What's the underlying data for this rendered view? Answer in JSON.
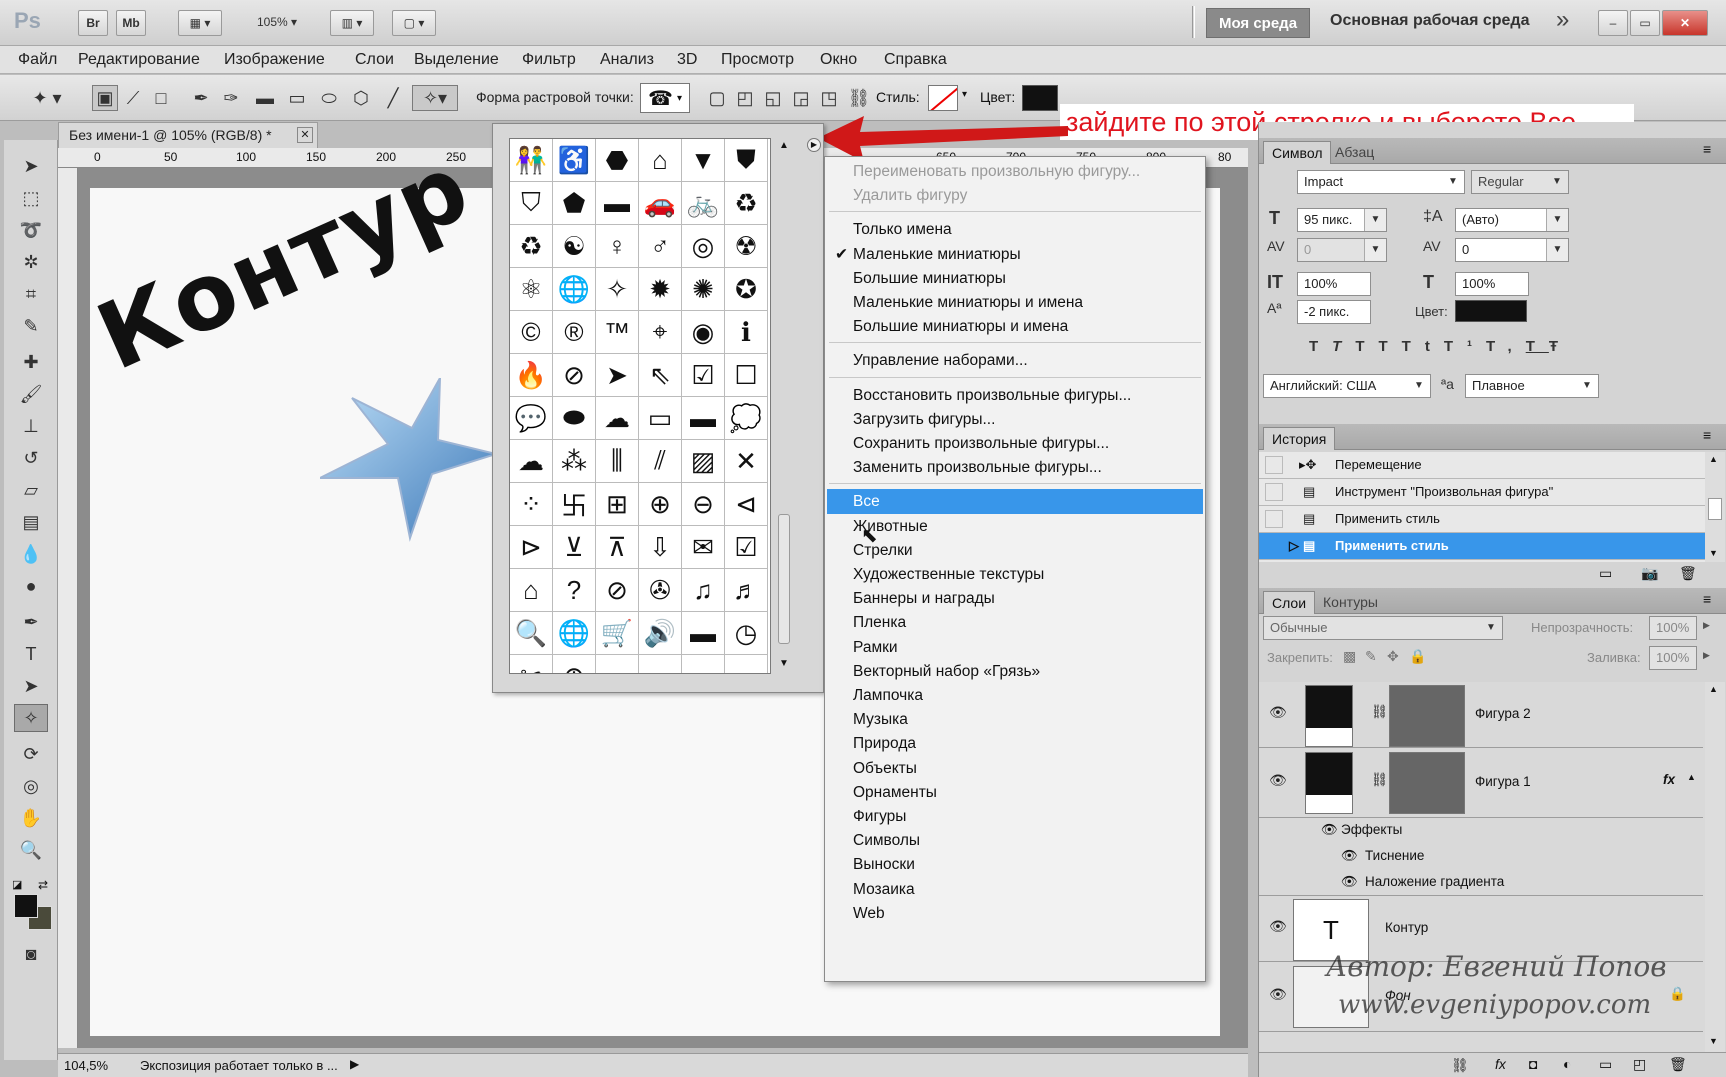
{
  "titlebar": {
    "app_logo": "Ps",
    "br": "Br",
    "mb": "Mb",
    "zoom": "105%",
    "workspace_active": "Моя среда",
    "workspace_main": "Основная рабочая среда",
    "more": "»"
  },
  "menu": [
    "Файл",
    "Редактирование",
    "Изображение",
    "Слои",
    "Выделение",
    "Фильтр",
    "Анализ",
    "3D",
    "Просмотр",
    "Окно",
    "Справка"
  ],
  "options": {
    "shape_label": "Форма растровой точки:",
    "style_label": "Стиль:",
    "color_label": "Цвет:"
  },
  "document": {
    "tab_title": "Без имени-1 @ 105% (RGB/8) *",
    "ruler_ticks": [
      "0",
      "50",
      "100",
      "150",
      "200",
      "250"
    ],
    "ruler_ticks_right": [
      "600",
      "650",
      "700",
      "750",
      "800",
      "80"
    ],
    "canvas_text": "Контур",
    "zoom_status": "104,5%",
    "status_text": "Экспозиция работает только в ..."
  },
  "annotation": "зайдите по этой стрелке и выберете Все",
  "shape_grid": [
    "👫",
    "♿",
    "⬣",
    "⌂",
    "▼",
    "⛊",
    "⛉",
    "⬟",
    "▬",
    "🚗",
    "🚲",
    "♻",
    "♻",
    "☯",
    "♀",
    "♂",
    "◎",
    "☢",
    "⚛",
    "🌐",
    "✧",
    "✹",
    "✺",
    "✪",
    "©",
    "®",
    "™",
    "⌖",
    "◉",
    "ℹ",
    "🔥",
    "⊘",
    "➤",
    "⇖",
    "☑",
    "☐",
    "💬",
    "⬬",
    "☁",
    "▭",
    "▬",
    "💭",
    "☁",
    "⁂",
    "⫼",
    "⫽",
    "▨",
    "✕",
    "⁘",
    "卐",
    "⊞",
    "⊕",
    "⊖",
    "⊲",
    "⊳",
    "⊻",
    "⊼",
    "⇩",
    "✉",
    "☑",
    "⌂",
    "?",
    "⊘",
    "✇",
    "♫",
    "♬",
    "🔍",
    "🌐",
    "🛒",
    "🔊",
    "▬",
    "◷",
    "✂",
    "⊕",
    "",
    "",
    "",
    ""
  ],
  "flyout": [
    {
      "label": "Переименовать произвольную фигуру...",
      "state": "disabled"
    },
    {
      "label": "Удалить фигуру",
      "state": "disabled"
    },
    {
      "label": "Только имена",
      "state": "normal"
    },
    {
      "label": "Маленькие миниатюры",
      "state": "checked"
    },
    {
      "label": "Большие миниатюры",
      "state": "normal"
    },
    {
      "label": "Маленькие миниатюры и имена",
      "state": "normal"
    },
    {
      "label": "Большие миниатюры и имена",
      "state": "normal"
    },
    {
      "label": "Управление наборами...",
      "state": "normal"
    },
    {
      "label": "Восстановить произвольные фигуры...",
      "state": "normal"
    },
    {
      "label": "Загрузить фигуры...",
      "state": "normal"
    },
    {
      "label": "Сохранить произвольные фигуры...",
      "state": "normal"
    },
    {
      "label": "Заменить произвольные фигуры...",
      "state": "normal"
    },
    {
      "label": "Все",
      "state": "selected"
    },
    {
      "label": "Животные",
      "state": "normal"
    },
    {
      "label": "Стрелки",
      "state": "normal"
    },
    {
      "label": "Художественные текстуры",
      "state": "normal"
    },
    {
      "label": "Баннеры и награды",
      "state": "normal"
    },
    {
      "label": "Пленка",
      "state": "normal"
    },
    {
      "label": "Рамки",
      "state": "normal"
    },
    {
      "label": "Векторный набор «Грязь»",
      "state": "normal"
    },
    {
      "label": "Лампочка",
      "state": "normal"
    },
    {
      "label": "Музыка",
      "state": "normal"
    },
    {
      "label": "Природа",
      "state": "normal"
    },
    {
      "label": "Объекты",
      "state": "normal"
    },
    {
      "label": "Орнаменты",
      "state": "normal"
    },
    {
      "label": "Фигуры",
      "state": "normal"
    },
    {
      "label": "Символы",
      "state": "normal"
    },
    {
      "label": "Выноски",
      "state": "normal"
    },
    {
      "label": "Мозаика",
      "state": "normal"
    },
    {
      "label": "Web",
      "state": "normal"
    }
  ],
  "character": {
    "tab_active": "Символ",
    "tab_other": "Абзац",
    "font_family": "Impact",
    "font_style": "Regular",
    "font_size": "95 пикс.",
    "leading": "(Авто)",
    "kerning": "0",
    "tracking": "0",
    "vscale": "100%",
    "hscale": "100%",
    "baseline": "-2 пикс.",
    "color_label": "Цвет:",
    "language": "Английский: США",
    "aa_label": "ªa",
    "antialias": "Плавное",
    "style_buttons": [
      "T",
      "T",
      "TT",
      "Tt",
      "T¹",
      "T,",
      "T",
      "Ŧ"
    ]
  },
  "history": {
    "tab": "История",
    "rows": [
      {
        "label": "Перемещение",
        "selected": false
      },
      {
        "label": "Инструмент \"Произвольная фигура\"",
        "selected": false
      },
      {
        "label": "Применить стиль",
        "selected": false
      },
      {
        "label": "Применить стиль",
        "selected": true
      }
    ]
  },
  "layers": {
    "tab_active": "Слои",
    "tab_other": "Контуры",
    "blend_mode": "Обычные",
    "opacity_label": "Непрозрачность:",
    "opacity": "100%",
    "lock_label": "Закрепить:",
    "fill_label": "Заливка:",
    "fill": "100%",
    "fx": "fx",
    "rows": [
      {
        "name": "Фигура 2"
      },
      {
        "name": "Фигура 1"
      },
      {
        "name": "Контур",
        "thumb_text": "T"
      },
      {
        "name": "Фон"
      }
    ],
    "effects_label": "Эффекты",
    "effect_items": [
      "Тиснение",
      "Наложение градиента"
    ]
  },
  "watermark": {
    "line1": "Автор: Евгений Попов",
    "line2": "www.evgeniypopov.com"
  },
  "colors": {
    "accent_selected": "#3896ea",
    "annotation_red": "#e0141e",
    "arrow_red": "#d01818"
  }
}
